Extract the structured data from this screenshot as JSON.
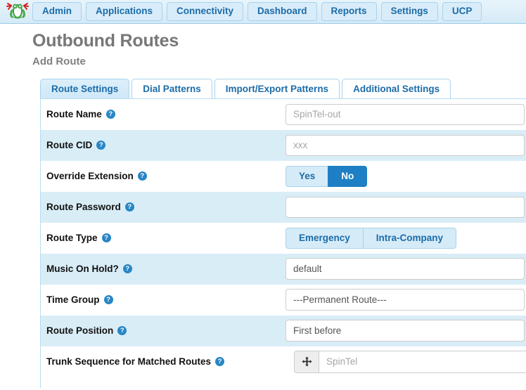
{
  "navbar": {
    "logo_icon": "freepbx-frog-logo",
    "items": [
      {
        "label": "Admin"
      },
      {
        "label": "Applications"
      },
      {
        "label": "Connectivity"
      },
      {
        "label": "Dashboard"
      },
      {
        "label": "Reports"
      },
      {
        "label": "Settings"
      },
      {
        "label": "UCP"
      }
    ]
  },
  "page": {
    "title": "Outbound Routes",
    "subtitle": "Add Route"
  },
  "tabs": [
    {
      "label": "Route Settings",
      "active": true
    },
    {
      "label": "Dial Patterns",
      "active": false
    },
    {
      "label": "Import/Export Patterns",
      "active": false
    },
    {
      "label": "Additional Settings",
      "active": false
    }
  ],
  "form": {
    "help_glyph": "?",
    "route_name": {
      "label": "Route Name",
      "value": "",
      "placeholder": "SpinTel-out"
    },
    "route_cid": {
      "label": "Route CID",
      "value": "",
      "placeholder": "xxx"
    },
    "override_extension": {
      "label": "Override Extension",
      "options": [
        "Yes",
        "No"
      ],
      "selected": "No"
    },
    "route_password": {
      "label": "Route Password",
      "value": "",
      "placeholder": ""
    },
    "route_type": {
      "label": "Route Type",
      "options": [
        "Emergency",
        "Intra-Company"
      ],
      "selected": ""
    },
    "music_on_hold": {
      "label": "Music On Hold?",
      "value": "default"
    },
    "time_group": {
      "label": "Time Group",
      "value": "---Permanent Route---"
    },
    "route_position": {
      "label": "Route Position",
      "value": "First before"
    },
    "trunk_sequence": {
      "label": "Trunk Sequence for Matched Routes",
      "drag_icon": "move-arrows-icon",
      "value": "SpinTel"
    }
  },
  "colors": {
    "nav_bg": "#d5eaf7",
    "nav_text": "#1b6ca8",
    "stripe": "#d9edf7",
    "accent_active": "#1f7fc4",
    "title_gray": "#777777"
  }
}
